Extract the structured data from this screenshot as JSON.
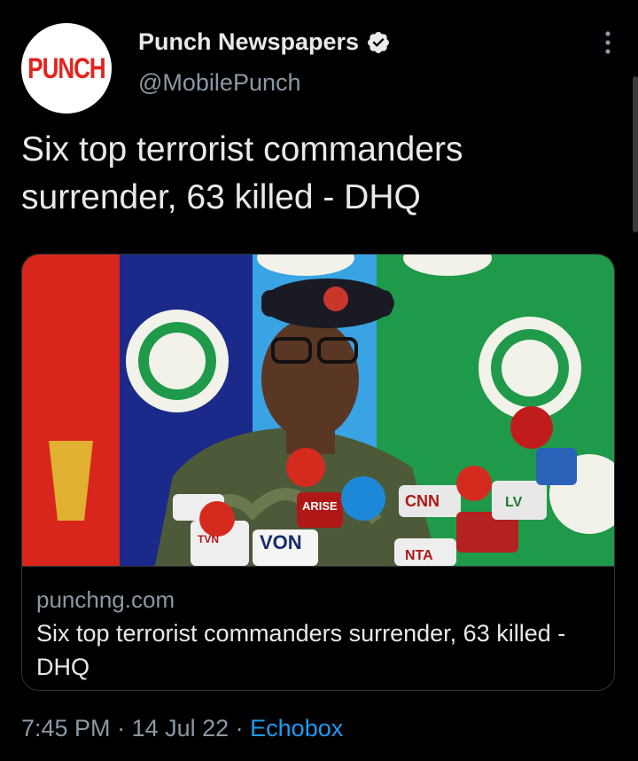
{
  "author": {
    "avatar_text": "PUNCH",
    "display_name": "Punch Newspapers",
    "handle": "@MobilePunch",
    "verified_icon": "verified-badge-icon"
  },
  "more_icon": "more-dots-icon",
  "tweet": {
    "text": "Six top terrorist commanders surrender, 63 killed - DHQ"
  },
  "card": {
    "domain": "punchng.com",
    "title": "Six top terrorist commanders surrender, 63 killed - DHQ",
    "image_mic_labels": [
      "ARISE NEWS",
      "VON",
      "CNN",
      "LV",
      "TVN",
      "NTA"
    ]
  },
  "footer": {
    "time": "7:45 PM",
    "separator1": " · ",
    "date": "14 Jul 22",
    "separator2": " · ",
    "source": "Echobox"
  },
  "colors": {
    "background": "#000000",
    "text_primary": "#e7e9ea",
    "text_secondary": "#8b98a5",
    "link": "#1d9bf0",
    "punch_red": "#e3241b"
  }
}
